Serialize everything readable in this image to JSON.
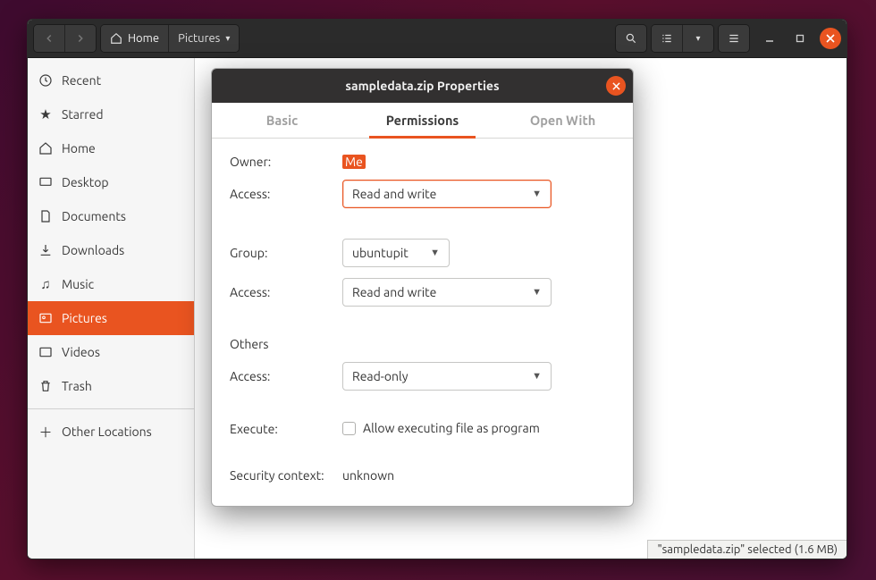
{
  "header": {
    "breadcrumb_home": "Home",
    "breadcrumb_current": "Pictures"
  },
  "sidebar": {
    "items": [
      {
        "label": "Recent"
      },
      {
        "label": "Starred"
      },
      {
        "label": "Home"
      },
      {
        "label": "Desktop"
      },
      {
        "label": "Documents"
      },
      {
        "label": "Downloads"
      },
      {
        "label": "Music"
      },
      {
        "label": "Pictures"
      },
      {
        "label": "Videos"
      },
      {
        "label": "Trash"
      }
    ],
    "other_locations": "Other Locations"
  },
  "statusbar": "\"sampledata.zip\" selected  (1.6 MB)",
  "dialog": {
    "title": "sampledata.zip Properties",
    "tabs": {
      "basic": "Basic",
      "permissions": "Permissions",
      "openwith": "Open With"
    },
    "labels": {
      "owner": "Owner:",
      "access": "Access:",
      "group": "Group:",
      "others": "Others",
      "execute": "Execute:",
      "security": "Security context:"
    },
    "values": {
      "owner_me": "Me",
      "owner_access": "Read and write",
      "group_name": "ubuntupit",
      "group_access": "Read and write",
      "others_access": "Read-only",
      "execute_label": "Allow executing file as program",
      "security_context": "unknown"
    }
  }
}
